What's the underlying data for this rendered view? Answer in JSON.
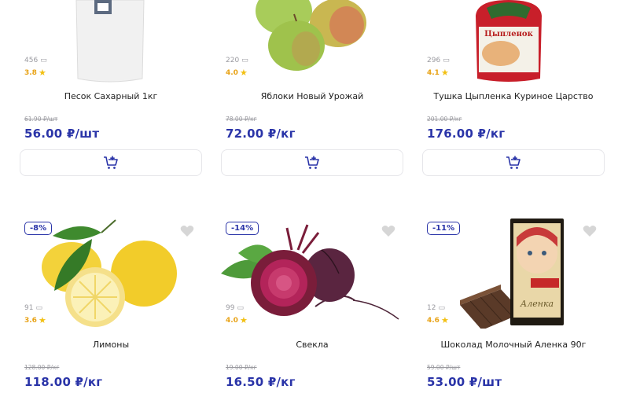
{
  "products": [
    {
      "title": "Песок Сахарный 1кг",
      "reviews": "456",
      "rating": "3.8",
      "old_price": "61.90 ₽/шт",
      "price": "56.00 ₽/шт"
    },
    {
      "title": "Яблоки Новый Урожай",
      "reviews": "220",
      "rating": "4.0",
      "old_price": "78.00 ₽/кг",
      "price": "72.00 ₽/кг"
    },
    {
      "title": "Тушка Цыпленка Куриное Царство",
      "reviews": "296",
      "rating": "4.1",
      "old_price": "201.00 ₽/кг",
      "price": "176.00 ₽/кг"
    },
    {
      "title": "Лимоны",
      "reviews": "91",
      "rating": "3.6",
      "old_price": "128.00 ₽/кг",
      "price": "118.00 ₽/кг",
      "discount": "-8%"
    },
    {
      "title": "Свекла",
      "reviews": "99",
      "rating": "4.0",
      "old_price": "19.00 ₽/кг",
      "price": "16.50 ₽/кг",
      "discount": "-14%"
    },
    {
      "title": "Шоколад Молочный Аленка 90г",
      "reviews": "12",
      "rating": "4.6",
      "old_price": "59.00 ₽/шт",
      "price": "53.00 ₽/шт",
      "discount": "-11%"
    }
  ],
  "packaging_text": {
    "chicken_brand": "Цыпленок",
    "chocolate_brand": "Аленка"
  },
  "icons": {
    "cart": "add-to-cart-icon",
    "heart": "favorite-icon",
    "star": "star-icon",
    "reviews": "comment-icon"
  },
  "colors": {
    "accent": "#2a34a8",
    "star": "#f2c012",
    "muted": "#9a9aa0",
    "border": "#e6e6ea"
  }
}
